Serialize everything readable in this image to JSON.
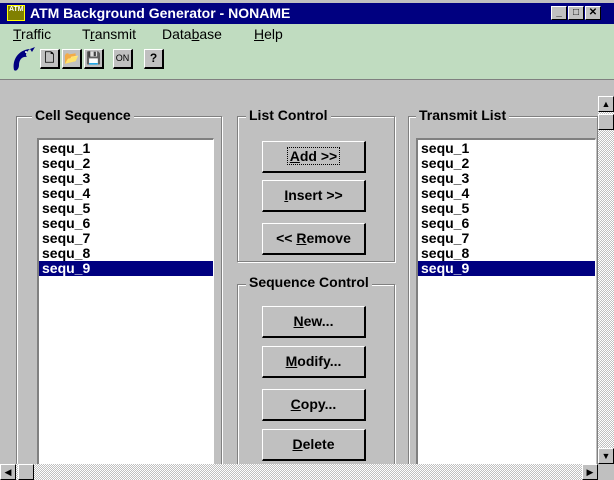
{
  "window": {
    "title": "ATM Background Generator - NONAME",
    "icon_text": "ATM",
    "caption_buttons": {
      "minimize": "_",
      "maximize": "□",
      "close": "✕"
    }
  },
  "menu": [
    {
      "label_pre": "",
      "mnemonic": "T",
      "label_post": "raffic"
    },
    {
      "label_pre": "T",
      "mnemonic": "r",
      "label_post": "ansmit"
    },
    {
      "label_pre": "Data",
      "mnemonic": "b",
      "label_post": "ase"
    },
    {
      "label_pre": "",
      "mnemonic": "H",
      "label_post": "elp"
    }
  ],
  "toolbar": {
    "logo": "dolphin-logo",
    "new_glyph": "🗋",
    "open_glyph": "📂",
    "save_glyph": "💾",
    "on_label": "ON",
    "help_glyph": "?"
  },
  "cell_sequence": {
    "label": "Cell Sequence",
    "items": [
      "sequ_1",
      "sequ_2",
      "sequ_3",
      "sequ_4",
      "sequ_5",
      "sequ_6",
      "sequ_7",
      "sequ_8",
      "sequ_9"
    ],
    "selected_index": 8
  },
  "list_control": {
    "label": "List Control",
    "add": {
      "pre": "",
      "mnemonic": "A",
      "post": "dd >>"
    },
    "insert": {
      "pre": "",
      "mnemonic": "I",
      "post": "nsert >>"
    },
    "remove": {
      "pre": "<< ",
      "mnemonic": "R",
      "post": "emove"
    }
  },
  "sequence_control": {
    "label": "Sequence Control",
    "new": {
      "pre": "",
      "mnemonic": "N",
      "post": "ew..."
    },
    "modify": {
      "pre": "",
      "mnemonic": "M",
      "post": "odify..."
    },
    "copy": {
      "pre": "",
      "mnemonic": "C",
      "post": "opy..."
    },
    "delete": {
      "pre": "",
      "mnemonic": "D",
      "post": "elete"
    }
  },
  "transmit_list": {
    "label": "Transmit List",
    "items": [
      "sequ_1",
      "sequ_2",
      "sequ_3",
      "sequ_4",
      "sequ_5",
      "sequ_6",
      "sequ_7",
      "sequ_8",
      "sequ_9"
    ],
    "selected_index": 8
  },
  "colors": {
    "titlebar": "#000080",
    "selection": "#000080",
    "menubar": "#c0dcc0",
    "face": "#c0c0c0"
  }
}
